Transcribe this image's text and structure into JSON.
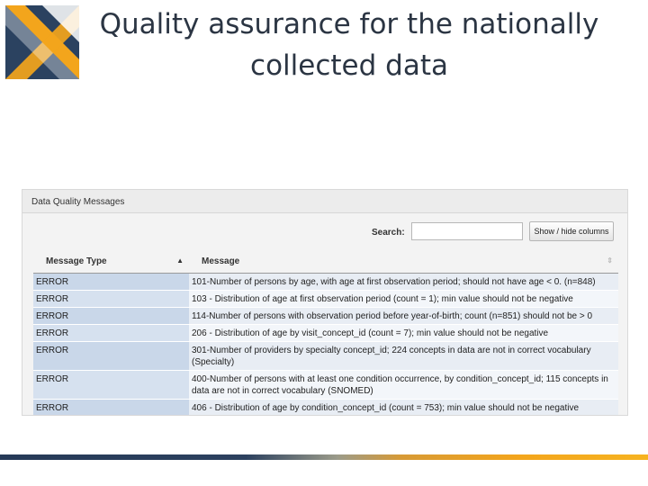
{
  "slide": {
    "title": "Quality assurance for the nationally collected data"
  },
  "colors": {
    "title_text": "#2b3543",
    "logo_blue": "#2b4260",
    "logo_orange": "#f3a51c",
    "error_cell": "#c9d7e9",
    "message_cell": "#e8edf4",
    "footer_left": "#263a57",
    "footer_right": "#f6b320"
  },
  "panel": {
    "header": "Data Quality Messages",
    "search_label": "Search:",
    "search_value": "",
    "colvis_label": "Show / hide columns"
  },
  "table": {
    "columns": [
      {
        "label": "Message Type",
        "sort": "ascending"
      },
      {
        "label": "Message",
        "sort": "none"
      }
    ],
    "rows": [
      {
        "type": "ERROR",
        "message": "101-Number of persons by age, with age at first observation period; should not have age < 0. (n=848)"
      },
      {
        "type": "ERROR",
        "message": "103 - Distribution of age at first observation period (count = 1); min value should not be negative"
      },
      {
        "type": "ERROR",
        "message": "114-Number of persons with observation period before year-of-birth; count (n=851) should not be > 0"
      },
      {
        "type": "ERROR",
        "message": "206 - Distribution of age by visit_concept_id (count = 7); min value should not be negative"
      },
      {
        "type": "ERROR",
        "message": "301-Number of providers by specialty concept_id; 224 concepts in data are not in correct vocabulary (Specialty)"
      },
      {
        "type": "ERROR",
        "message": "400-Number of persons with at least one condition occurrence, by condition_concept_id; 115 concepts in data are not in correct vocabulary (SNOMED)"
      },
      {
        "type": "ERROR",
        "message": "406 - Distribution of age by condition_concept_id (count = 753); min value should not be negative"
      }
    ]
  }
}
